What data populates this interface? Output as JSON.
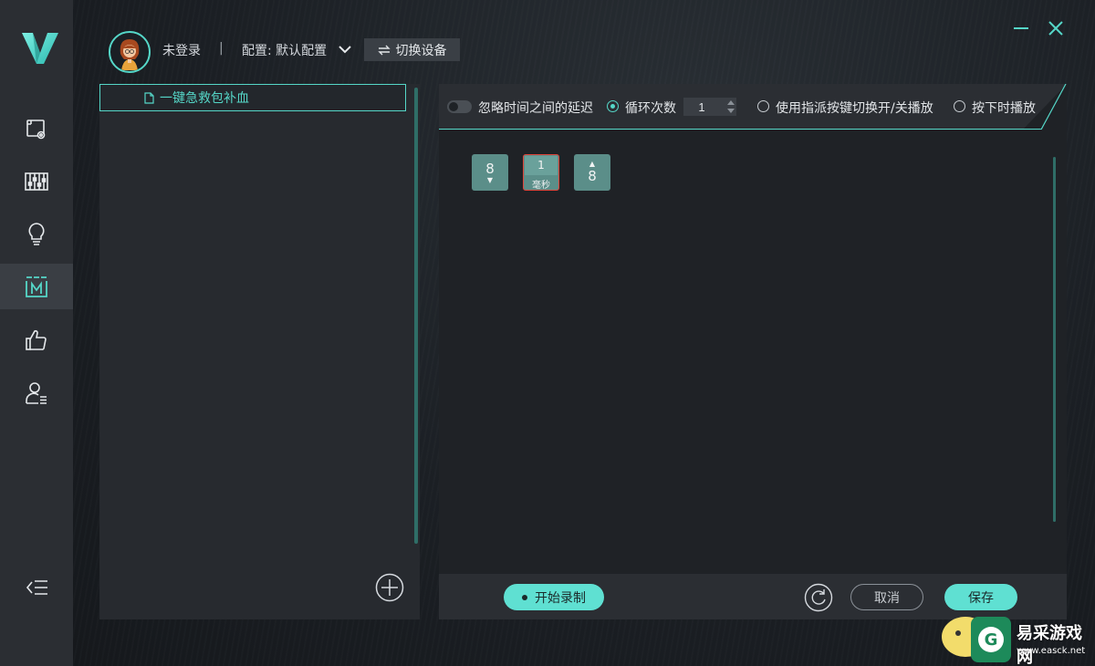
{
  "header": {
    "login_status": "未登录",
    "separator": "|",
    "config_label": "配置: 默认配置",
    "switch_device_label": "切换设备",
    "switch_icon": "swap-arrows-icon"
  },
  "sidebar": {
    "items": [
      {
        "name": "screen-settings",
        "icon": "screen-gear-icon"
      },
      {
        "name": "equalizer",
        "icon": "sliders-icon"
      },
      {
        "name": "lighting",
        "icon": "lightbulb-icon"
      },
      {
        "name": "macro",
        "icon": "macro-m-icon",
        "active": true
      },
      {
        "name": "recommend",
        "icon": "thumbs-up-icon"
      },
      {
        "name": "account",
        "icon": "user-list-icon"
      }
    ],
    "collapse_icon": "collapse-menu-icon"
  },
  "macro_list": {
    "items": [
      {
        "label": "一键急救包补血",
        "selected": true
      }
    ],
    "add_icon": "plus-circle-icon"
  },
  "toolbar": {
    "ignore_delay_label": "忽略时间之间的延迟",
    "loop_count_label": "循环次数",
    "loop_count_value": "1",
    "toggle_play_label": "使用指派按键切换开/关播放",
    "hold_play_label": "按下时播放",
    "selected_mode": "loop_count"
  },
  "macro_steps": [
    {
      "type": "key",
      "key": "8",
      "direction": "down",
      "arrow": "▼"
    },
    {
      "type": "delay",
      "value": "1",
      "unit": "毫秒"
    },
    {
      "type": "key",
      "key": "8",
      "direction": "up",
      "arrow": "▲"
    }
  ],
  "footer": {
    "record_label": "开始录制",
    "cancel_label": "取消",
    "save_label": "保存",
    "reset_icon": "refresh-icon"
  },
  "watermark": {
    "site_name": "易采游戏网",
    "site_url": "www.easck.net"
  },
  "colors": {
    "accent": "#55d7c8",
    "button": "#5fe0d2",
    "sidebar": "#2b2e33",
    "key_block": "#5b8e89",
    "delay_border": "#e0453a"
  }
}
